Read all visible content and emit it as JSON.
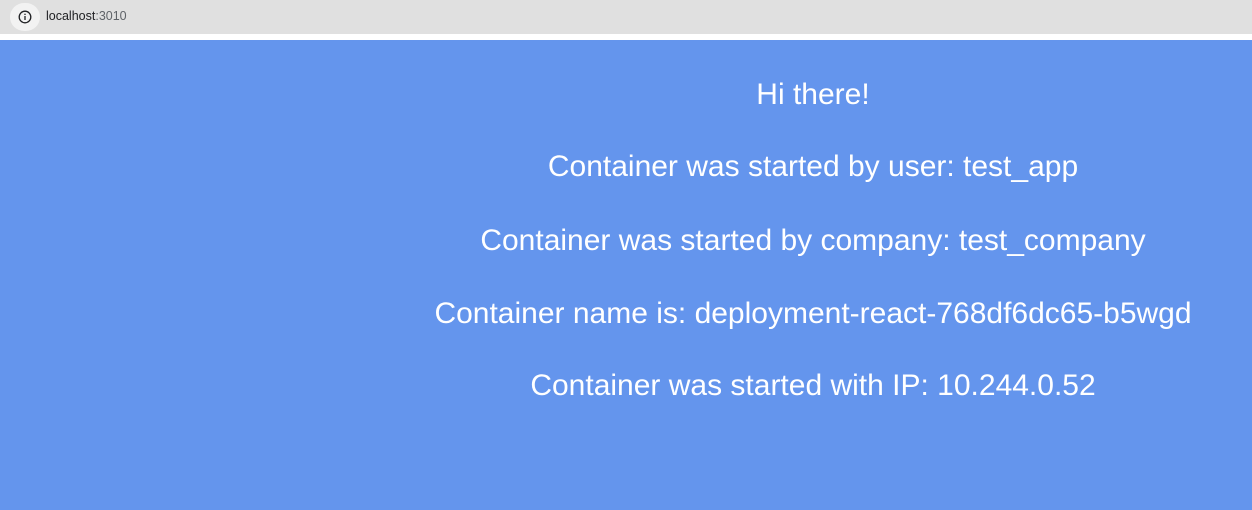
{
  "browser": {
    "url_host": "localhost",
    "url_port": ":3010",
    "info_icon": "info-icon"
  },
  "page": {
    "background_color": "#6495ed",
    "text_color": "#ffffff",
    "greeting": "Hi there!",
    "lines": [
      "Container was started by user: test_app",
      "Container was started by company: test_company",
      "Container name is: deployment-react-768df6dc65-b5wgd",
      "Container was started with IP: 10.244.0.52"
    ]
  }
}
